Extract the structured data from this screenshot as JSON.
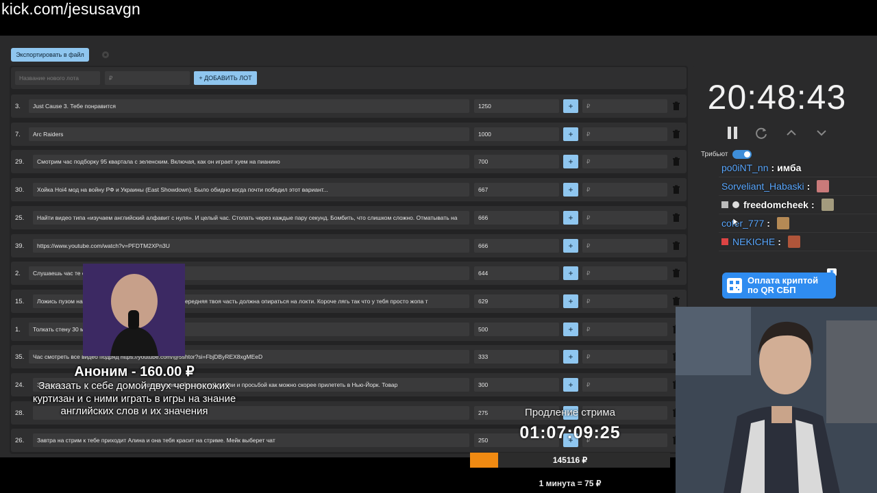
{
  "url_bar": {
    "text": "kick.com/jesusavgn"
  },
  "toolbar": {
    "export_label": "Экспортировать в файл"
  },
  "add_lot": {
    "name_placeholder": "Название нового лота",
    "price_placeholder": "₽",
    "add_label": "+ ДОБАВИТЬ ЛОТ"
  },
  "lots": [
    {
      "num": "3.",
      "name": "Just Cause 3. Тебе понравится",
      "amount": "1250",
      "plus": "+",
      "rub": "₽"
    },
    {
      "num": "7.",
      "name": "Arc Raiders",
      "amount": "1000",
      "plus": "+",
      "rub": "₽"
    },
    {
      "num": "29.",
      "name": "Смотрим час подборку 95 квартала с зеленским. Включая, как он играет хуем на пианино",
      "amount": "700",
      "plus": "+",
      "rub": "₽"
    },
    {
      "num": "30.",
      "name": "Хойка Hoi4 мод на войну РФ и Украины (East Showdown). Было обидно когда почти победил этот вариант...",
      "amount": "667",
      "plus": "+",
      "rub": "₽"
    },
    {
      "num": "25.",
      "name": "Найти видео типа «изучаем английский алфавит с нуля». И целый час. Стопать через каждые пару секунд. Бомбить, что слишком сложно. Отматывать на",
      "amount": "666",
      "plus": "+",
      "rub": "₽"
    },
    {
      "num": "39.",
      "name": "https://www.youtube.com/watch?v=PFDTM2XPn3U",
      "amount": "666",
      "plus": "+",
      "rub": "₽"
    },
    {
      "num": "2.",
      "name": "Слушаешь час те с",
      "name_tail": "2",
      "amount": "644",
      "plus": "+",
      "rub": "₽"
    },
    {
      "num": "15.",
      "name": "Ложись пузом на",
      "name_tail": "жопу. Передняя твоя часть должна опираться на локти. Короче лягь так что у тебя просто жопа т",
      "amount": "629",
      "plus": "+",
      "rub": "₽"
    },
    {
      "num": "1.",
      "name": "Толкать стену 30 м",
      "amount": "500",
      "plus": "+",
      "rub": "₽"
    },
    {
      "num": "35.",
      "name": "Час смотреть все видео подряд https://youtube.com/@5shtor?si=FbjDByREX8xgMEeD",
      "amount": "333",
      "plus": "+",
      "rub": "₽"
    },
    {
      "num": "24.",
      "name": "Записать",
      "name_tail": "признанием в безответной любви и просьбой как можно скорее прилететь в Нью-Йорк. Товар",
      "amount": "300",
      "plus": "+",
      "rub": "₽"
    },
    {
      "num": "28.",
      "name": "",
      "amount": "275",
      "plus": "+",
      "rub": "₽"
    },
    {
      "num": "26.",
      "name": "Завтра на стрим к тебе приходит Алина и она тебя красит на стриме. Мейк выберет чат",
      "amount": "250",
      "plus": "+",
      "rub": "₽"
    }
  ],
  "timer": {
    "time": "20:48:43",
    "tribute_label": "Трибьют"
  },
  "chat": [
    {
      "user": "po0iNT_nn",
      "sep": ":",
      "msg": "имба"
    },
    {
      "user": "Sorveliant_Habaski",
      "sep": ":",
      "msg": ""
    },
    {
      "user": "freedomcheek",
      "sep": ":",
      "msg": ""
    },
    {
      "user": "cofer_777",
      "sep": ":",
      "msg": ""
    },
    {
      "user": "NEKICHE",
      "sep": ":",
      "msg": ""
    }
  ],
  "qr_button": {
    "line1": "Оплата криптой",
    "line2": "по QR СБП"
  },
  "donation": {
    "title": "Аноним - 160.00 ₽",
    "message": "Заказать к себе домой двух чернокожих куртизан и с ними играть в игры на знание английских слов и их значения"
  },
  "extension": {
    "label": "Продление стрима",
    "time": "01:07:09:25",
    "total": "145116 ₽",
    "rate": "1 минута = 75 ₽",
    "progress_fraction": 0.14
  },
  "colors": {
    "accent": "#8fc6ef",
    "progress": "#f08a12",
    "qr": "#2f8cf0"
  },
  "icons": [
    "gear-icon",
    "trash-icon",
    "pause-icon",
    "refresh-icon",
    "chevron-up-icon",
    "chevron-down-icon",
    "qr-icon"
  ]
}
